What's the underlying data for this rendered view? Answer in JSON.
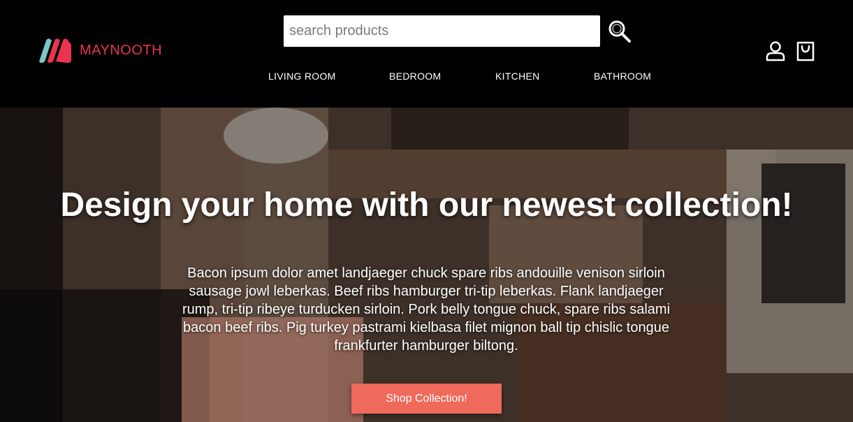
{
  "brand": {
    "name": "MAYNOOTH",
    "accent": "#e8344e",
    "logo_colors": [
      "#7cc6c6",
      "#e8344e"
    ]
  },
  "search": {
    "placeholder": "search products",
    "icon": "search-icon"
  },
  "nav": {
    "items": [
      {
        "label": "LIVING ROOM"
      },
      {
        "label": "BEDROOM"
      },
      {
        "label": "KITCHEN"
      },
      {
        "label": "BATHROOM"
      }
    ]
  },
  "actions": {
    "account_icon": "user-icon",
    "cart_icon": "shopping-bag-icon"
  },
  "hero": {
    "title": "Design your home with our newest collection!",
    "body": "Bacon ipsum dolor amet landjaeger chuck spare ribs andouille venison sirloin sausage jowl leberkas. Beef ribs hamburger tri-tip leberkas. Flank landjaeger rump, tri-tip ribeye turducken sirloin. Pork belly tongue chuck, spare ribs salami bacon beef ribs. Pig turkey pastrami kielbasa filet mignon ball tip chislic tongue frankfurter hamburger biltong.",
    "cta_label": "Shop Collection!",
    "cta_color": "#ef6a5a"
  }
}
